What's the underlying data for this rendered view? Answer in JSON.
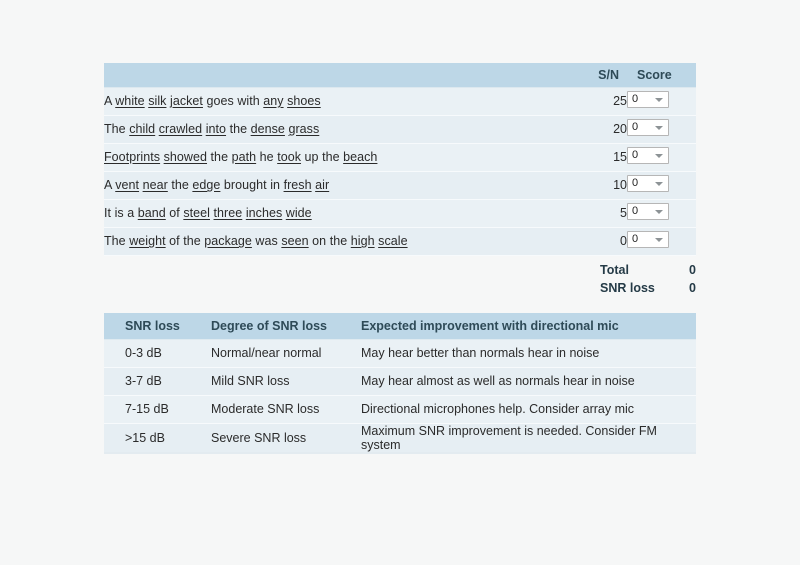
{
  "score_table": {
    "headers": {
      "sentence": "",
      "sn": "S/N",
      "score": "Score"
    },
    "rows": [
      {
        "parts": [
          {
            "t": "A ",
            "u": false
          },
          {
            "t": "white",
            "u": true
          },
          {
            "t": " ",
            "u": false
          },
          {
            "t": "silk",
            "u": true
          },
          {
            "t": " ",
            "u": false
          },
          {
            "t": "jacket",
            "u": true
          },
          {
            "t": " goes with ",
            "u": false
          },
          {
            "t": "any",
            "u": true
          },
          {
            "t": " ",
            "u": false
          },
          {
            "t": "shoes",
            "u": true
          }
        ],
        "sn": "25",
        "score": "0"
      },
      {
        "parts": [
          {
            "t": "The ",
            "u": false
          },
          {
            "t": "child",
            "u": true
          },
          {
            "t": " ",
            "u": false
          },
          {
            "t": "crawled",
            "u": true
          },
          {
            "t": " ",
            "u": false
          },
          {
            "t": "into",
            "u": true
          },
          {
            "t": " the ",
            "u": false
          },
          {
            "t": "dense",
            "u": true
          },
          {
            "t": " ",
            "u": false
          },
          {
            "t": "grass",
            "u": true
          }
        ],
        "sn": "20",
        "score": "0"
      },
      {
        "parts": [
          {
            "t": "Footprints",
            "u": true
          },
          {
            "t": " ",
            "u": false
          },
          {
            "t": "showed",
            "u": true
          },
          {
            "t": " the ",
            "u": false
          },
          {
            "t": "path",
            "u": true
          },
          {
            "t": " he ",
            "u": false
          },
          {
            "t": "took",
            "u": true
          },
          {
            "t": " up the ",
            "u": false
          },
          {
            "t": "beach",
            "u": true
          }
        ],
        "sn": "15",
        "score": "0"
      },
      {
        "parts": [
          {
            "t": "A ",
            "u": false
          },
          {
            "t": "vent",
            "u": true
          },
          {
            "t": " ",
            "u": false
          },
          {
            "t": "near",
            "u": true
          },
          {
            "t": " the ",
            "u": false
          },
          {
            "t": "edge",
            "u": true
          },
          {
            "t": " brought in ",
            "u": false
          },
          {
            "t": "fresh",
            "u": true
          },
          {
            "t": " ",
            "u": false
          },
          {
            "t": "air",
            "u": true
          }
        ],
        "sn": "10",
        "score": "0"
      },
      {
        "parts": [
          {
            "t": "It is a ",
            "u": false
          },
          {
            "t": "band",
            "u": true
          },
          {
            "t": " of ",
            "u": false
          },
          {
            "t": "steel",
            "u": true
          },
          {
            "t": " ",
            "u": false
          },
          {
            "t": "three",
            "u": true
          },
          {
            "t": " ",
            "u": false
          },
          {
            "t": "inches",
            "u": true
          },
          {
            "t": " ",
            "u": false
          },
          {
            "t": "wide",
            "u": true
          }
        ],
        "sn": "5",
        "score": "0"
      },
      {
        "parts": [
          {
            "t": "The ",
            "u": false
          },
          {
            "t": "weight",
            "u": true
          },
          {
            "t": " of the ",
            "u": false
          },
          {
            "t": "package",
            "u": true
          },
          {
            "t": " was ",
            "u": false
          },
          {
            "t": "seen",
            "u": true
          },
          {
            "t": " on the ",
            "u": false
          },
          {
            "t": "high",
            "u": true
          },
          {
            "t": " ",
            "u": false
          },
          {
            "t": "scale",
            "u": true
          }
        ],
        "sn": "0",
        "score": "0"
      }
    ]
  },
  "totals": {
    "total_label": "Total",
    "total_value": "0",
    "snr_loss_label": "SNR loss",
    "snr_loss_value": "0"
  },
  "snr_table": {
    "headers": [
      "SNR loss",
      "Degree of SNR loss",
      "Expected improvement with directional mic"
    ],
    "rows": [
      [
        "0-3 dB",
        "Normal/near normal",
        "May hear better than normals hear in noise"
      ],
      [
        "3-7 dB",
        "Mild SNR loss",
        "May hear almost as well as normals hear in noise"
      ],
      [
        "7-15 dB",
        "Moderate SNR loss",
        "Directional microphones help. Consider array mic"
      ],
      [
        ">15 dB",
        "Severe SNR loss",
        "Maximum SNR improvement is needed. Consider FM system"
      ]
    ]
  },
  "icons": {
    "dropdown": "chevron-down-icon"
  },
  "colors": {
    "page_bg": "#f6f7f7",
    "header_bg": "#bdd7e7",
    "row_bg": "#eaf1f5",
    "row_alt_bg": "#e6eef3",
    "header_text": "#2e4a57",
    "body_text": "#2b2b2b"
  }
}
